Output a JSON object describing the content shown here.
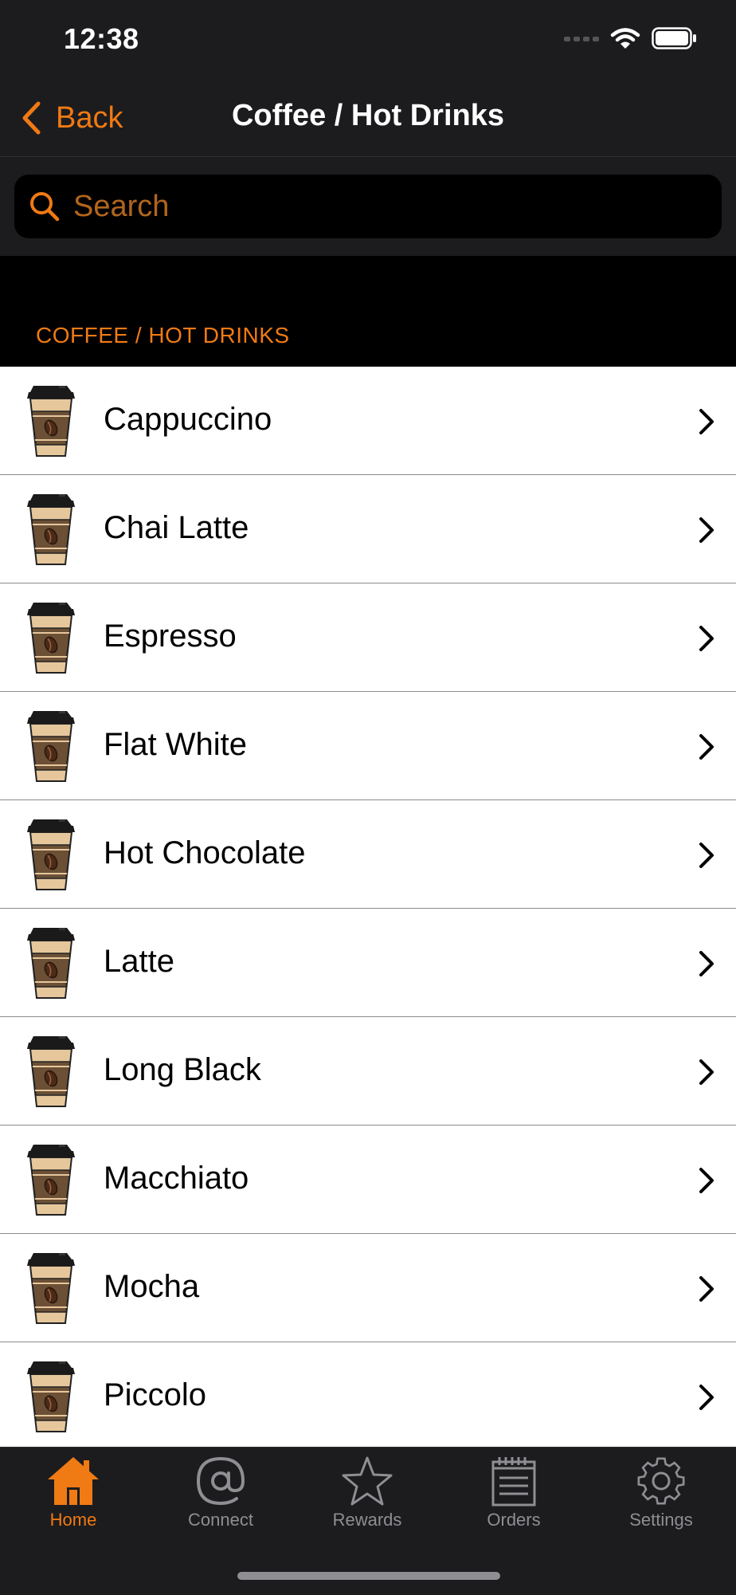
{
  "status_bar": {
    "time": "12:38"
  },
  "nav": {
    "back_label": "Back",
    "title": "Coffee / Hot Drinks"
  },
  "search": {
    "placeholder": "Search"
  },
  "section": {
    "title": "COFFEE / HOT DRINKS"
  },
  "items": [
    {
      "label": "Cappuccino"
    },
    {
      "label": "Chai Latte"
    },
    {
      "label": "Espresso"
    },
    {
      "label": "Flat White"
    },
    {
      "label": "Hot Chocolate"
    },
    {
      "label": "Latte"
    },
    {
      "label": "Long Black"
    },
    {
      "label": "Macchiato"
    },
    {
      "label": "Mocha"
    },
    {
      "label": "Piccolo"
    }
  ],
  "tabs": [
    {
      "label": "Home",
      "icon": "house-icon",
      "active": true
    },
    {
      "label": "Connect",
      "icon": "at-sign-icon",
      "active": false
    },
    {
      "label": "Rewards",
      "icon": "star-icon",
      "active": false
    },
    {
      "label": "Orders",
      "icon": "notepad-icon",
      "active": false
    },
    {
      "label": "Settings",
      "icon": "gear-icon",
      "active": false
    }
  ],
  "colors": {
    "accent": "#f07a14",
    "bar_background": "#1c1c1e",
    "inactive_tab": "#8e8e93"
  }
}
